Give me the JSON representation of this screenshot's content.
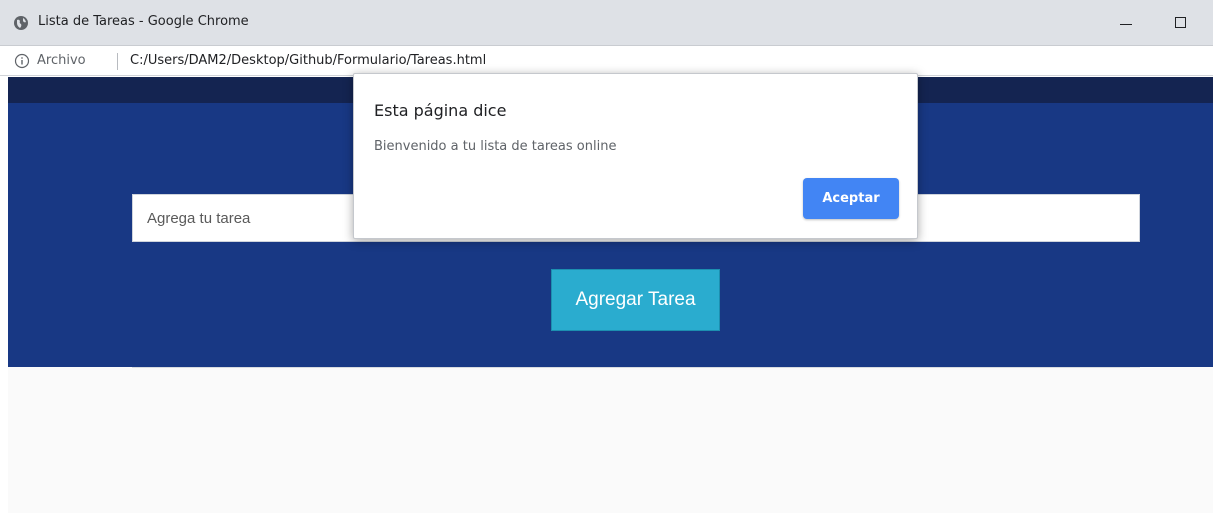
{
  "window": {
    "title": "Lista de Tareas - Google Chrome",
    "icon": "globe-icon"
  },
  "address_bar": {
    "info_icon": "info-icon",
    "scheme_label": "Archivo",
    "url": "C:/Users/DAM2/Desktop/Github/Formulario/Tareas.html"
  },
  "page": {
    "task_input_placeholder": "Agrega tu tarea",
    "add_task_label": "Agregar Tarea"
  },
  "dialog": {
    "title": "Esta página dice",
    "message": "Bienvenido a tu lista de tareas online",
    "accept_label": "Aceptar"
  },
  "colors": {
    "header_dark": "#142451",
    "hero_blue": "#183884",
    "add_button": "#2aaccf",
    "accept_button": "#4285f4"
  }
}
